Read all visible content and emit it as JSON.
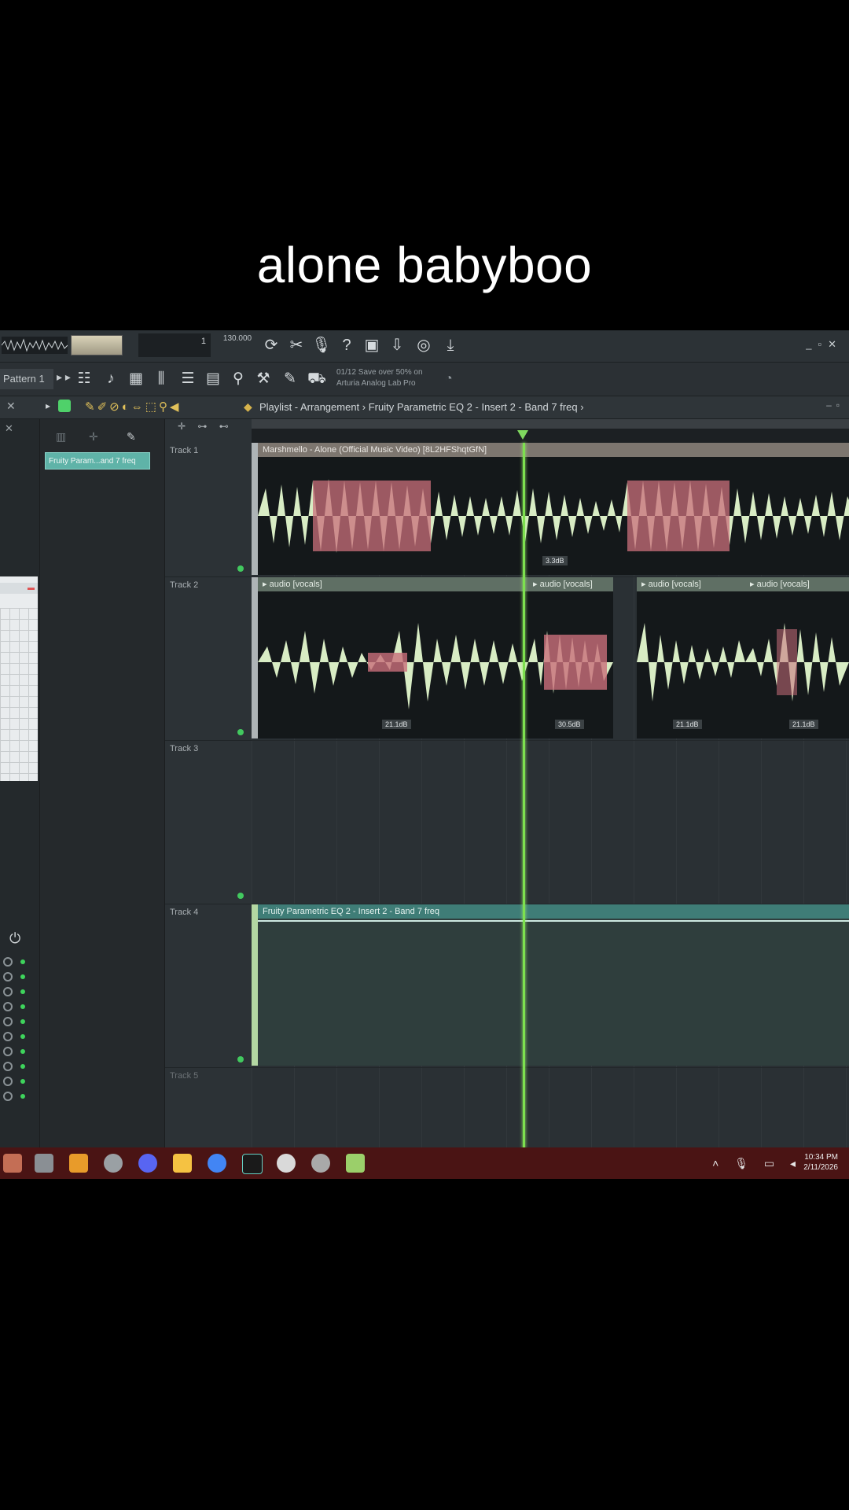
{
  "caption": "alone babyboo",
  "toolbar": {
    "pattern_selector": "Pattern 1",
    "promo_line1": "01/12  Save over 50% on",
    "promo_line2": "Arturia Analog Lab Pro",
    "tempo": "130.000",
    "counter": "1"
  },
  "playlist_bar": {
    "title": "Playlist - Arrangement › Fruity Parametric EQ 2 - Insert 2 - Band 7 freq ›"
  },
  "browser": {
    "selected_clip": "Fruity Param...and 7 freq"
  },
  "tracks": [
    {
      "name": "Track 1"
    },
    {
      "name": "Track 2"
    },
    {
      "name": "Track 3"
    },
    {
      "name": "Track 4"
    },
    {
      "name": "Track 5"
    }
  ],
  "clips": {
    "track1": {
      "title": "Marshmello - Alone (Official Music Video) [8L2HFShqtGfN]",
      "db": "3.3dB"
    },
    "track2": [
      {
        "title": "audio [vocals]",
        "db": "21.1dB"
      },
      {
        "title": "audio [vocals]",
        "db": "30.5dB"
      },
      {
        "title": "audio [vocals]",
        "db": "21.1dB"
      },
      {
        "title": "audio [vocals]",
        "db": "21.1dB"
      }
    ],
    "track4": {
      "title": "Fruity Parametric EQ 2 - Insert 2 - Band 7 freq"
    }
  },
  "taskbar": {
    "time": "10:34 PM",
    "date": "2/11/2026"
  },
  "colors": {
    "wave_light": "#d8ecc4",
    "wave_red": "#c96f7b",
    "automation": "#3f7d77",
    "playhead": "#7de04f",
    "taskbar": "#4a1414"
  },
  "icons": [
    "metronome-icon",
    "cut-icon",
    "mic-icon",
    "help-icon",
    "save-icon",
    "render-icon",
    "chat-icon",
    "download-icon"
  ]
}
